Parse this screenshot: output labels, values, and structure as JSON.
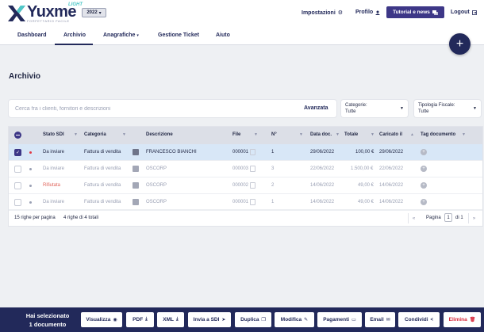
{
  "header": {
    "logo_text": "Yuxme",
    "logo_edition": "LIGHT",
    "logo_tagline": "FORFETTARIO FACILE",
    "year": "2022",
    "links": {
      "settings": "Impostazioni",
      "profile": "Profilo",
      "tutorial": "Tutorial e news",
      "logout": "Logout"
    }
  },
  "nav": {
    "items": [
      "Dashboard",
      "Archivio",
      "Anagrafiche",
      "Gestione Ticket",
      "Aiuto"
    ],
    "active": "Archivio"
  },
  "fab": {
    "label": "+"
  },
  "page": {
    "title": "Archivio",
    "search": {
      "placeholder": "Cerca fra i clienti, fornitori e descrizioni",
      "advanced": "Avanzata"
    },
    "filters": [
      {
        "label": "Categorie:",
        "value": "Tutte"
      },
      {
        "label": "Tipologia Fiscale:",
        "value": "Tutte"
      }
    ]
  },
  "table": {
    "columns": [
      "Stato SDI",
      "Categoria",
      "Descrizione",
      "File",
      "N°",
      "Data doc.",
      "Totale",
      "Caricato il",
      "Tag documento"
    ],
    "rows": [
      {
        "stato": "Da inviare",
        "categoria": "Fattura di vendita",
        "descrizione": "FRANCESCO BIANCHI",
        "file": "000001",
        "numero": "1",
        "data_doc": "29/06/2022",
        "totale": "100,00 €",
        "caricato": "29/06/2022",
        "selected": true,
        "status_color": "#e03a46"
      },
      {
        "stato": "Da inviare",
        "categoria": "Fattura di vendita",
        "descrizione": "OSCORP",
        "file": "000003",
        "numero": "3",
        "data_doc": "22/06/2022",
        "totale": "1.500,00 €",
        "caricato": "22/06/2022",
        "selected": false,
        "status_color": "#9aa0b4"
      },
      {
        "stato": "Rifiutata",
        "categoria": "Fattura di vendita",
        "descrizione": "OSCORP",
        "file": "000002",
        "numero": "2",
        "data_doc": "14/06/2022",
        "totale": "49,00 €",
        "caricato": "14/06/2022",
        "selected": false,
        "status_color": "#e0645a"
      },
      {
        "stato": "Da inviare",
        "categoria": "Fattura di vendita",
        "descrizione": "OSCORP",
        "file": "000001",
        "numero": "1",
        "data_doc": "14/06/2022",
        "totale": "49,00 €",
        "caricato": "14/06/2022",
        "selected": false,
        "status_color": "#9aa0b4"
      }
    ],
    "footer": {
      "rows_per_page": "15 righe per pagina",
      "count": "4 righe di 4 totali",
      "page_label": "Pagina",
      "page_value": "1",
      "page_total": "di 1",
      "prev": "«",
      "next": "»"
    }
  },
  "action_bar": {
    "selection_line1": "Hai selezionato",
    "selection_line2": "1 documento",
    "buttons": [
      "Visualizza",
      "PDF",
      "XML",
      "Invia a SDI",
      "Duplica",
      "Modifica",
      "Pagamenti",
      "Email",
      "Condividi",
      "Elimina"
    ]
  },
  "colors": {
    "primary": "#22295a",
    "accent": "#3d3787",
    "selected_row": "#d8e7f7",
    "danger": "#d8283b",
    "brand_light": "#4fc8c8"
  }
}
